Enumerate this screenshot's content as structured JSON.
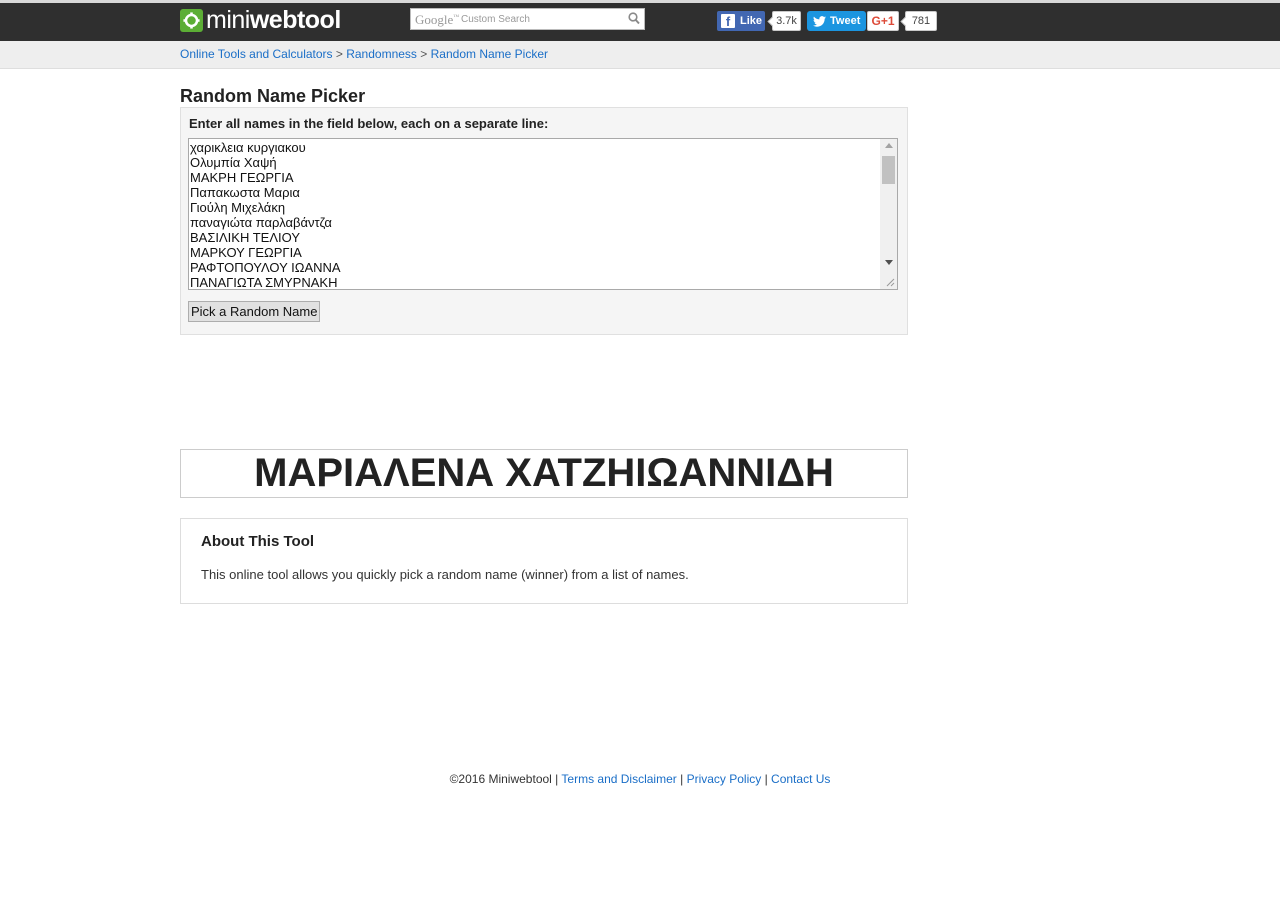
{
  "header": {
    "logo_light": "mini",
    "logo_bold": "webtool",
    "search": {
      "brand": "Google",
      "placeholder": "Custom Search"
    },
    "social": {
      "facebook_label": "Like",
      "facebook_count": "3.7k",
      "twitter_label": "Tweet",
      "gplus_label": "G+1",
      "gplus_count": "781"
    }
  },
  "breadcrumb": {
    "items": [
      "Online Tools and Calculators",
      "Randomness",
      "Random Name Picker"
    ],
    "separator": " > "
  },
  "page_title": "Random Name Picker",
  "form": {
    "instruction": "Enter all names in the field below, each on a separate line:",
    "names": [
      "χαρικλεια κυργιακου",
      "Ολυμπία Χαψή",
      "ΜΑΚΡΗ ΓΕΩΡΓΙΑ",
      "Παπακωστα Μαρια",
      "Γιούλη Μιχελάκη",
      "παναγιώτα παρλαβάντζα",
      "ΒΑΣΙΛΙΚΗ ΤΕΛΙΟΥ",
      "ΜΑΡΚΟΥ ΓΕΩΡΓΙΑ",
      "ΡΑΦΤΟΠΟΥΛΟΥ ΙΩΑΝΝΑ",
      "ΠΑΝΑΓΙΩΤΑ ΣΜΥΡΝΑΚΗ"
    ],
    "button_label": "Pick a Random Name"
  },
  "result": "ΜΑΡΙΑΛΕΝΑ ΧΑΤΖΗΙΩΑΝΝΙΔΗ",
  "about": {
    "title": "About This Tool",
    "text": "This online tool allows you quickly pick a random name (winner) from a list of names."
  },
  "footer": {
    "copyright": "©2016 Miniwebtool",
    "links": [
      "Terms and Disclaimer",
      "Privacy Policy",
      "Contact Us"
    ],
    "separator": " | "
  },
  "colors": {
    "header_bg": "#2f2f2f",
    "link": "#1a6ec7",
    "logo_green": "#5cae35",
    "facebook": "#4267b2",
    "twitter": "#1b95e0"
  },
  "icons": [
    "gear-logo-icon",
    "search-icon",
    "facebook-icon",
    "twitter-bird-icon",
    "scroll-up-arrow-icon",
    "scroll-down-arrow-icon",
    "resize-grip-icon"
  ]
}
